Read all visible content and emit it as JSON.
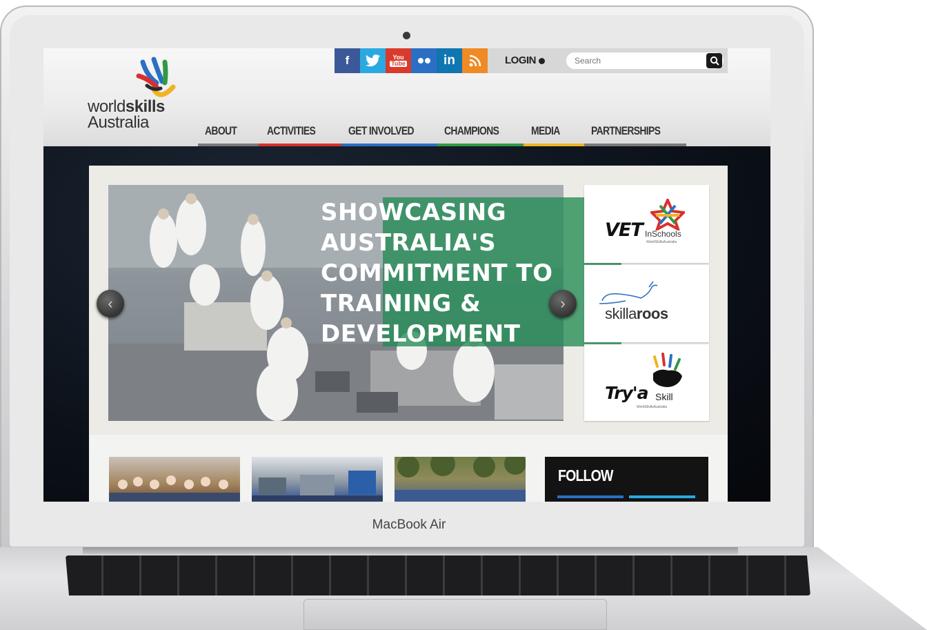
{
  "device": {
    "model_label": "MacBook Air"
  },
  "site": {
    "logo": {
      "line1_prefix": "world",
      "line1_bold": "skills",
      "line2": "Australia"
    },
    "topbar": {
      "social": [
        {
          "name": "facebook",
          "glyph": "f",
          "color": "#3b5998"
        },
        {
          "name": "twitter",
          "glyph": "t",
          "color": "#2aa9e0"
        },
        {
          "name": "youtube",
          "glyph": "You\nTube",
          "color": "#d93a2b"
        },
        {
          "name": "flickr",
          "glyph": "••",
          "color": "#2b6fc4"
        },
        {
          "name": "linkedin",
          "glyph": "in",
          "color": "#0f76b0"
        },
        {
          "name": "rss",
          "glyph": "rss",
          "color": "#f08a24"
        }
      ],
      "login_label": "LOGIN",
      "search_placeholder": "Search"
    },
    "nav": [
      {
        "label": "ABOUT",
        "color": "#7a7a7a"
      },
      {
        "label": "ACTIVITIES",
        "color": "#d8302f"
      },
      {
        "label": "GET INVOLVED",
        "color": "#2b6fc4"
      },
      {
        "label": "CHAMPIONS",
        "color": "#2f9a46"
      },
      {
        "label": "MEDIA",
        "color": "#f0b323"
      },
      {
        "label": "PARTNERSHIPS",
        "color": "#7a7a7a"
      }
    ],
    "hero": {
      "lines": [
        "SHOWCASING",
        "AUSTRALIA'S",
        "COMMITMENT TO",
        "TRAINING &",
        "DEVELOPMENT"
      ],
      "prev_glyph": "‹",
      "next_glyph": "›"
    },
    "side_cards": [
      {
        "big": "VET",
        "small": "InSchools",
        "tiny": "WorldSkillsAustralia"
      },
      {
        "prefix": "skilla",
        "bold": "roos"
      },
      {
        "big": "Try'a",
        "small": "Skill",
        "tiny": "WorldSkillsAustralia"
      }
    ],
    "follow_label": "FOLLOW"
  }
}
